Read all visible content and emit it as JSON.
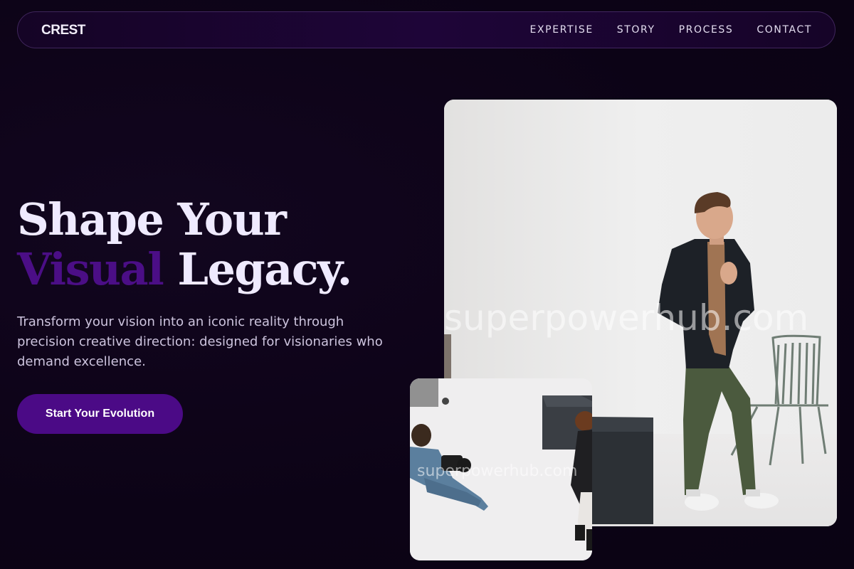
{
  "nav": {
    "logo": "CREST",
    "links": [
      "EXPERTISE",
      "STORY",
      "PROCESS",
      "CONTACT"
    ]
  },
  "hero": {
    "headline_line1": "Shape Your",
    "headline_accent": "Visual",
    "headline_line2_rest": " Legacy.",
    "subtext": "Transform your vision into an iconic reality through precision creative direction: designed for visionaries who demand excellence.",
    "cta_label": "Start Your Evolution"
  },
  "images": {
    "main_watermark": "superpowerhub.com",
    "small_watermark": "superpowerhub.com"
  },
  "colors": {
    "background": "#0c0316",
    "accent": "#4b0a86",
    "headline": "#efeaff"
  }
}
